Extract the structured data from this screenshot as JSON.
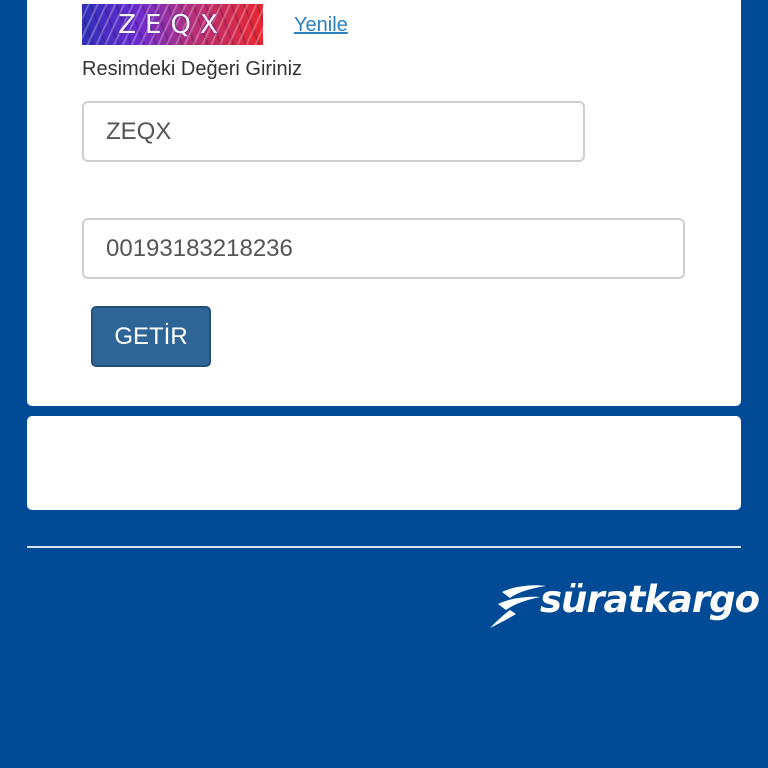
{
  "captcha": {
    "image_text": "ZEQX",
    "refresh_label": "Yenile",
    "label": "Resimdeki Değeri Giriniz",
    "input_value": "ZEQX"
  },
  "tracking": {
    "input_value": "00193183218236"
  },
  "actions": {
    "submit_label": "GETİR"
  },
  "footer": {
    "logo_text": "süratkargo"
  },
  "colors": {
    "background": "#004a96",
    "button": "#2f6496",
    "link": "#2a7fc0",
    "card": "#ffffff"
  }
}
